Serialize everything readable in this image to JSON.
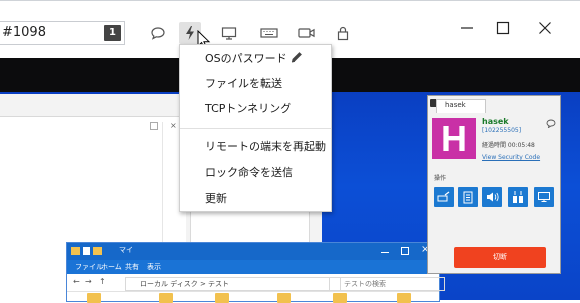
{
  "toolbar": {
    "session_id_text": "#1098",
    "session_badge": "1",
    "icons": [
      "chat-icon",
      "bolt-icon",
      "monitor-icon",
      "keyboard-icon",
      "camera-icon",
      "lock-icon"
    ]
  },
  "window_controls": [
    "minimize",
    "maximize",
    "close"
  ],
  "menu": {
    "items": [
      {
        "label": "OSのパスワード",
        "has_edit_icon": true
      },
      {
        "label": "ファイルを転送"
      },
      {
        "label": "TCPトンネリング"
      },
      {
        "label": "リモートの端末を再起動"
      },
      {
        "label": "ロック命令を送信"
      },
      {
        "label": "更新"
      }
    ]
  },
  "panel": {
    "tab_label": "hasek",
    "avatar_letter": "H",
    "user_name": "hasek",
    "user_id": "[102255505]",
    "elapsed": "経過時間 00:05:48",
    "security_link": "View Security Code",
    "ops_label": "操作",
    "disconnect_label": "切断"
  },
  "explorer": {
    "title": "マイ",
    "ribbon_tabs": [
      "ファイル",
      "ホーム",
      "共有",
      "表示"
    ],
    "path": "ローカル ディスク > テスト",
    "search_placeholder": "テストの検索"
  },
  "colors": {
    "accent": "#1c79d1",
    "avatar": "#c930a6",
    "disconnect": "#f0421f",
    "desktop": "#0c4fd6"
  }
}
